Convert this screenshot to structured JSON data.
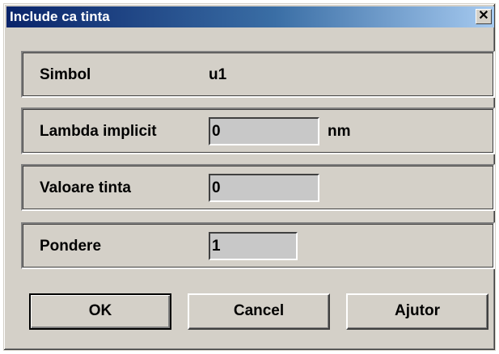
{
  "window": {
    "title": "Include ca tinta",
    "close_glyph": "✕"
  },
  "rows": {
    "simbol": {
      "label": "Simbol",
      "value": "u1"
    },
    "lambda": {
      "label": "Lambda implicit",
      "value": "0",
      "unit": "nm"
    },
    "valoare": {
      "label": "Valoare tinta",
      "value": "0"
    },
    "pondere": {
      "label": "Pondere",
      "value": "1"
    }
  },
  "buttons": {
    "ok": "OK",
    "cancel": "Cancel",
    "help": "Ajutor"
  },
  "colors": {
    "face": "#d4d0c8",
    "title_start": "#0a246a",
    "title_end": "#a6caf0",
    "field_bg": "#c8c8c8"
  }
}
